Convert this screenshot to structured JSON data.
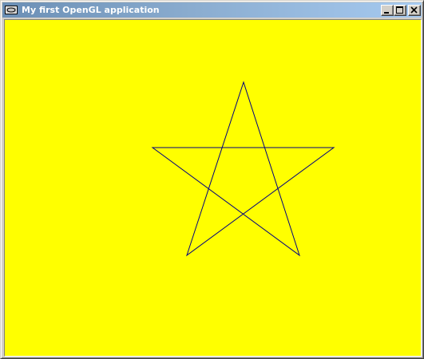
{
  "window": {
    "title": "My first OpenGL application",
    "app_icon": "opengl-app-icon",
    "controls": [
      "minimize-icon",
      "maximize-icon",
      "close-icon"
    ]
  },
  "canvas": {
    "background_color": "#ffff00",
    "shape": "pentagram",
    "stroke_color": "#000080"
  },
  "colors": {
    "titlebar_start": "#6b8fb5",
    "titlebar_end": "#a6caf0",
    "title_text": "#ffffff",
    "frame": "#d4d0c8"
  }
}
